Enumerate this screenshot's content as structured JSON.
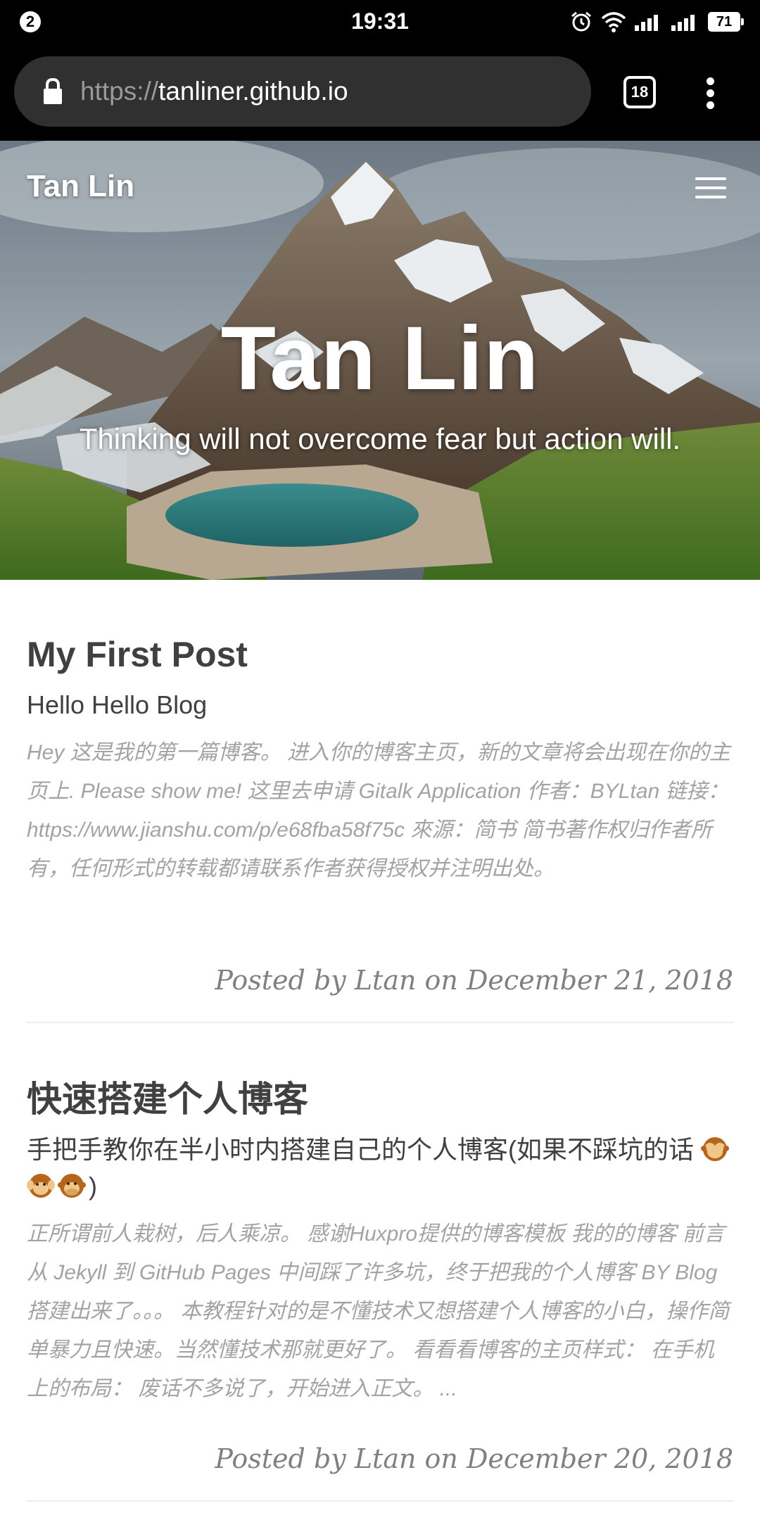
{
  "status_bar": {
    "notification_count": "2",
    "time": "19:31",
    "battery": "71"
  },
  "browser": {
    "url_prefix": "https://",
    "url_domain": "tanliner.github.io",
    "tab_count": "18"
  },
  "site": {
    "brand": "Tan Lin",
    "hero_title": "Tan Lin",
    "hero_subtitle": "Thinking will not overcome fear but action will."
  },
  "posts": [
    {
      "title": "My First Post",
      "subtitle": "Hello Hello Blog",
      "excerpt": "Hey 这是我的第一篇博客。 进入你的博客主页，新的文章将会出现在你的主页上. Please show me! 这里去申请 Gitalk Application 作者：BYLtan 链接：https://www.jianshu.com/p/e68fba58f75c 來源：简书 简书著作权归作者所有，任何形式的转载都请联系作者获得授权并注明出处。",
      "meta": "Posted by Ltan on December 21, 2018"
    },
    {
      "title": "快速搭建个人博客",
      "subtitle": "手把手教你在半小时内搭建自己的个人博客(如果不踩坑的话",
      "subtitle_end": ")",
      "emoji": [
        "see-no-evil-monkey",
        "hear-no-evil-monkey",
        "speak-no-evil-monkey"
      ],
      "excerpt": "正所谓前人栽树，后人乘凉。 感谢Huxpro提供的博客模板 我的的博客 前言 从 Jekyll 到 GitHub Pages 中间踩了许多坑，终于把我的个人博客 BY Blog搭建出来了。。。 本教程针对的是不懂技术又想搭建个人博客的小白，操作简单暴力且快速。当然懂技术那就更好了。 看看看博客的主页样式： 在手机上的布局： 废话不多说了，开始进入正文。 ...",
      "meta": "Posted by Ltan on December 20, 2018"
    }
  ]
}
